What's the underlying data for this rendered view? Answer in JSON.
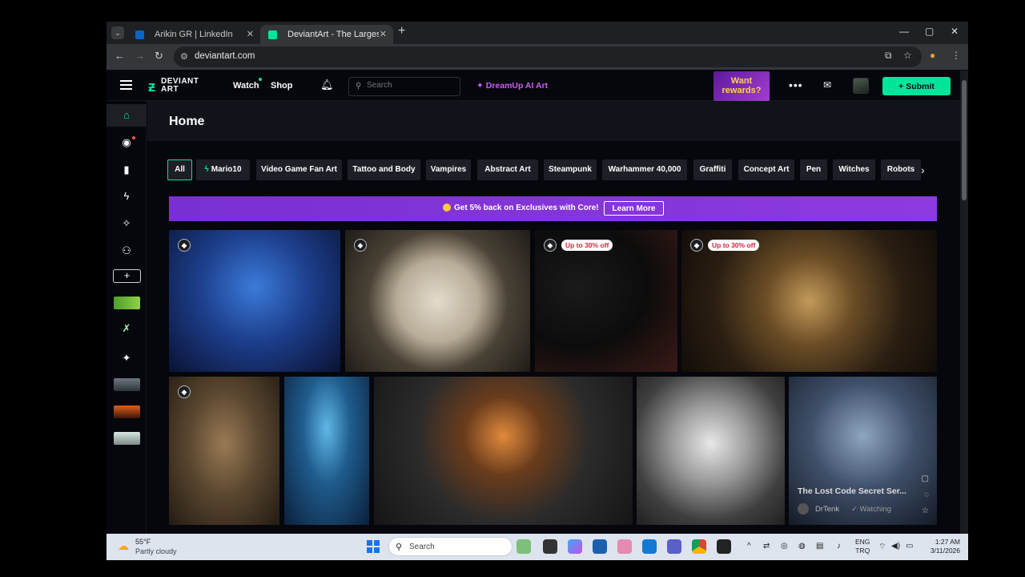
{
  "browser": {
    "tabs": [
      {
        "title": "Arikin GR | LinkedIn",
        "favicon_color": "#0a66c2",
        "active": false
      },
      {
        "title": "DeviantArt - The Largest Online",
        "favicon_color": "#00e59b",
        "active": true
      }
    ],
    "url": "deviantart.com",
    "new_tab": "+",
    "close": "✕",
    "minimize": "—",
    "maximize": "▢"
  },
  "header": {
    "logo_line1": "DEVIANT",
    "logo_line2": "ART",
    "watch": "Watch",
    "shop": "Shop",
    "search_placeholder": "Search",
    "dreamup": "DreamUp AI Art",
    "rewards_line1": "Want",
    "rewards_line2": "rewards?",
    "submit": "Submit",
    "accent": "#00e59b"
  },
  "rail": {
    "items": [
      "home-icon",
      "eye-icon",
      "bookmark-icon",
      "bolt-icon",
      "dreamup-icon",
      "groups-icon"
    ],
    "add": "+",
    "sparkle": "sparkle-icon"
  },
  "main": {
    "title": "Home",
    "chips": [
      "All",
      "Mario10",
      "Video Game Fan Art",
      "Tattoo and Body",
      "Vampires",
      "Abstract Art",
      "Steampunk",
      "Warhammer 40,000",
      "Graffiti",
      "Concept Art",
      "Pen",
      "Witches",
      "Robots"
    ],
    "banner_text": "Get 5% back on Exclusives with Core!",
    "banner_button": "Learn More",
    "sale_badge": "Up to 30% off",
    "featured": {
      "title": "The Lost Code Secret Ser...",
      "author": "DrTenk",
      "watching": "Watching"
    }
  },
  "taskbar": {
    "temp": "55°F",
    "weather": "Partly cloudy",
    "search": "Search",
    "lang_line1": "ENG",
    "lang_line2": "TRQ",
    "time": "1:27 AM",
    "date": "3/11/2026"
  }
}
